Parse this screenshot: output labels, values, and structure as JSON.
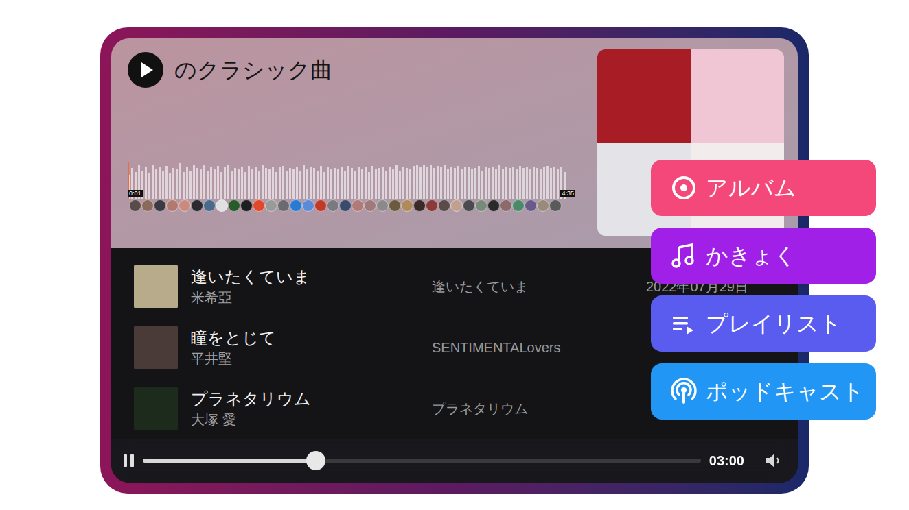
{
  "title": "のクラシック曲",
  "waveform": {
    "start": "0:01",
    "end": "4:35",
    "bars": [
      0.62,
      0.8,
      0.7,
      0.88,
      0.74,
      0.82,
      0.68,
      0.9,
      0.76,
      0.84,
      0.72,
      0.86,
      0.66,
      0.8,
      0.78,
      0.92,
      0.7,
      0.84,
      0.74,
      0.88,
      0.8,
      0.76,
      0.9,
      0.72,
      0.84,
      0.78,
      0.86,
      0.7,
      0.82,
      0.88,
      0.74,
      0.8,
      0.76,
      0.84,
      0.7,
      0.86,
      0.78,
      0.82,
      0.72,
      0.88,
      0.8,
      0.76,
      0.84,
      0.7,
      0.82,
      0.86,
      0.74,
      0.8,
      0.78,
      0.84,
      0.72,
      0.88,
      0.76,
      0.82,
      0.8,
      0.74,
      0.86,
      0.7,
      0.84,
      0.78,
      0.8,
      0.76,
      0.82,
      0.72,
      0.86,
      0.8,
      0.74,
      0.84,
      0.78,
      0.82,
      0.7,
      0.86,
      0.76,
      0.8,
      0.84,
      0.74,
      0.82,
      0.78,
      0.88,
      0.72,
      0.84,
      0.8,
      0.76,
      0.86,
      0.9,
      0.82,
      0.88,
      0.84,
      0.9,
      0.8,
      0.86,
      0.82,
      0.88,
      0.78,
      0.84,
      0.8,
      0.86,
      0.76,
      0.82,
      0.84,
      0.78,
      0.8,
      0.86,
      0.74,
      0.82,
      0.8,
      0.84,
      0.78,
      0.88,
      0.76,
      0.82,
      0.8,
      0.84,
      0.78,
      0.86,
      0.8,
      0.82,
      0.76,
      0.84,
      0.8,
      0.78,
      0.82,
      0.86,
      0.8,
      0.84,
      0.78,
      0.82,
      0.7
    ]
  },
  "comments": [
    {
      "color": "#5a4a48"
    },
    {
      "color": "#8a6a5a"
    },
    {
      "color": "#3a3a40"
    },
    {
      "color": "#b07a70"
    },
    {
      "color": "#c98a80"
    },
    {
      "color": "#2a2a30"
    },
    {
      "color": "#4a6a8a"
    },
    {
      "color": "#e0e0e0"
    },
    {
      "color": "#2a5a2a"
    },
    {
      "color": "#1e1e22"
    },
    {
      "color": "#e04a2a"
    },
    {
      "color": "#9a9a9a"
    },
    {
      "color": "#6a6a70"
    },
    {
      "color": "#2a7ad0"
    },
    {
      "color": "#5a8ad8"
    },
    {
      "color": "#c03a2a"
    },
    {
      "color": "#7a7a80"
    },
    {
      "color": "#3a4a6a"
    },
    {
      "color": "#b07a78"
    },
    {
      "color": "#a07a7a"
    },
    {
      "color": "#8a8a8a"
    },
    {
      "color": "#6a5a40"
    },
    {
      "color": "#b08a5a"
    },
    {
      "color": "#3a2a2a"
    },
    {
      "color": "#8a3a3a"
    },
    {
      "color": "#5a4a4a"
    },
    {
      "color": "#c0a090"
    },
    {
      "color": "#4a4a50"
    },
    {
      "color": "#7a8a7a"
    },
    {
      "color": "#2a2a2a"
    },
    {
      "color": "#8a6a6a"
    },
    {
      "color": "#4a8a6a"
    },
    {
      "color": "#6a5a8a"
    },
    {
      "color": "#9a8a7a"
    },
    {
      "color": "#5a5a5a"
    }
  ],
  "covers": [
    {
      "color": "#a81c26"
    },
    {
      "color": "#f0c6d4"
    },
    {
      "color": "#e4e4e8"
    },
    {
      "color": "#f2ecec"
    }
  ],
  "menu": [
    {
      "label": "アルバム",
      "kind": "album",
      "color": "#f5487a"
    },
    {
      "label": "かきょく",
      "kind": "song",
      "color": "#a020e8"
    },
    {
      "label": "プレイリスト",
      "kind": "playlist",
      "color": "#5a5cf0"
    },
    {
      "label": "ポッドキャスト",
      "kind": "podcast",
      "color": "#2196f5"
    }
  ],
  "songs": [
    {
      "title": "逢いたくていま",
      "artist": "米希亞",
      "album": "逢いたくていま",
      "date": "2022年07月29日",
      "color": "#b8ab8c"
    },
    {
      "title": "瞳をとじて",
      "artist": "平井堅",
      "album": "SENTIMENTALovers",
      "color": "#4b3b38"
    },
    {
      "title": "プラネタリウム",
      "artist": "大塚 愛",
      "album": "プラネタリウム",
      "color": "#1d2b1c"
    }
  ],
  "player": {
    "playing": true,
    "level": 0.31,
    "time": "03:00"
  }
}
